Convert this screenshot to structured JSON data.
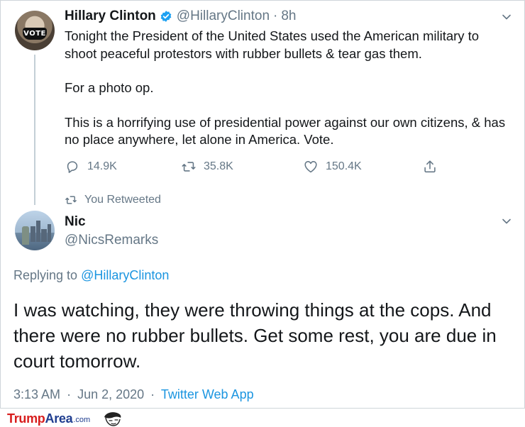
{
  "tweet1": {
    "name": "Hillary Clinton",
    "handle": "@HillaryClinton",
    "separator": "·",
    "time": "8h",
    "avatar_text": "VOTE",
    "body": [
      "Tonight the President of the United States used the American military to shoot peaceful protestors with rubber bullets & tear gas them.",
      "For a photo op.",
      "This is a horrifying use of presidential power against our own citizens, & has no place anywhere, let alone in America. Vote."
    ],
    "replies": "14.9K",
    "retweets": "35.8K",
    "likes": "150.4K",
    "icons": {
      "reply": "reply-icon",
      "retweet": "retweet-icon",
      "like": "heart-icon",
      "share": "share-icon",
      "verified": "verified-badge-icon",
      "more": "chevron-down-icon"
    }
  },
  "retweet_notice": "You Retweeted",
  "tweet2": {
    "name": "Nic",
    "handle": "@NicsRemarks",
    "replying_prefix": "Replying to",
    "replying_to": "@HillaryClinton",
    "body": "I was watching, they were throwing things at the cops. And there were no rubber bullets. Get some rest, you are due in court tomorrow.",
    "time": "3:13 AM",
    "date": "Jun 2, 2020",
    "separator": "·",
    "source": "Twitter Web App"
  },
  "watermark": {
    "part1": "Trump",
    "part2": "Area",
    "part3": ".com"
  },
  "colors": {
    "link": "#1b95e0",
    "muted": "#657786",
    "text": "#14171a",
    "verified": "#1da1f2",
    "watermark_red": "#d81e1e",
    "watermark_blue": "#1f3d8f"
  }
}
